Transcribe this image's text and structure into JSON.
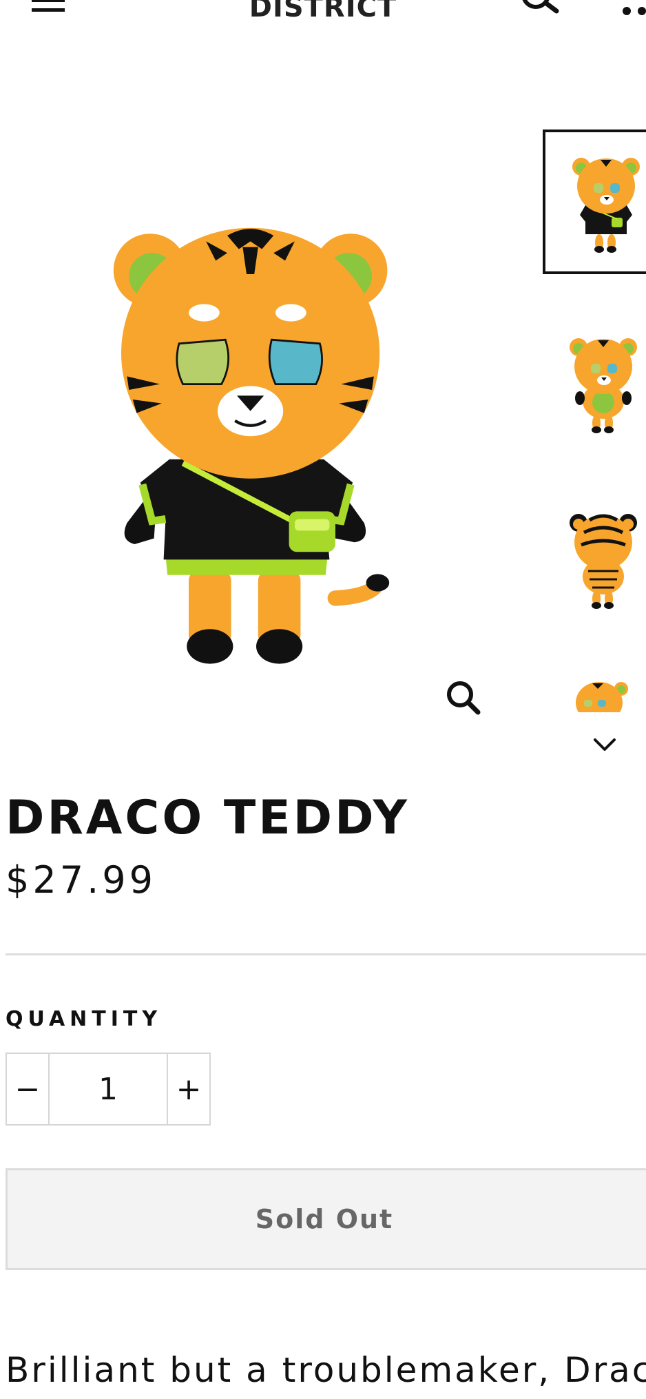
{
  "header": {
    "brand": "DISTRICT",
    "menu_icon": "hamburger-menu-icon",
    "search_icon": "search-icon",
    "more_icon": "more-dots-icon"
  },
  "gallery": {
    "main_image": "plush-tiger-front",
    "zoom_icon": "zoom-icon",
    "thumbnails": [
      {
        "image": "plush-tiger-front",
        "active": true
      },
      {
        "image": "plush-tiger-shirtless",
        "active": false
      },
      {
        "image": "plush-tiger-back",
        "active": false
      },
      {
        "image": "plush-tiger-head",
        "active": false
      }
    ],
    "scroll_icon": "chevron-down-icon"
  },
  "product": {
    "title": "DRACO TEDDY",
    "price": "$27.99",
    "quantity_label": "QUANTITY",
    "quantity_value": "1",
    "decrement_label": "−",
    "increment_label": "+",
    "sold_out_label": "Sold Out",
    "description": "Brilliant but a troublemaker, Draco"
  },
  "colors": {
    "tiger_orange": "#f7a52c",
    "accent_green": "#a6d92a",
    "shirt_black": "#111111",
    "eye_teal": "#58b8c9",
    "sold_out_bg": "#f3f3f3",
    "sold_out_text": "#666666"
  }
}
